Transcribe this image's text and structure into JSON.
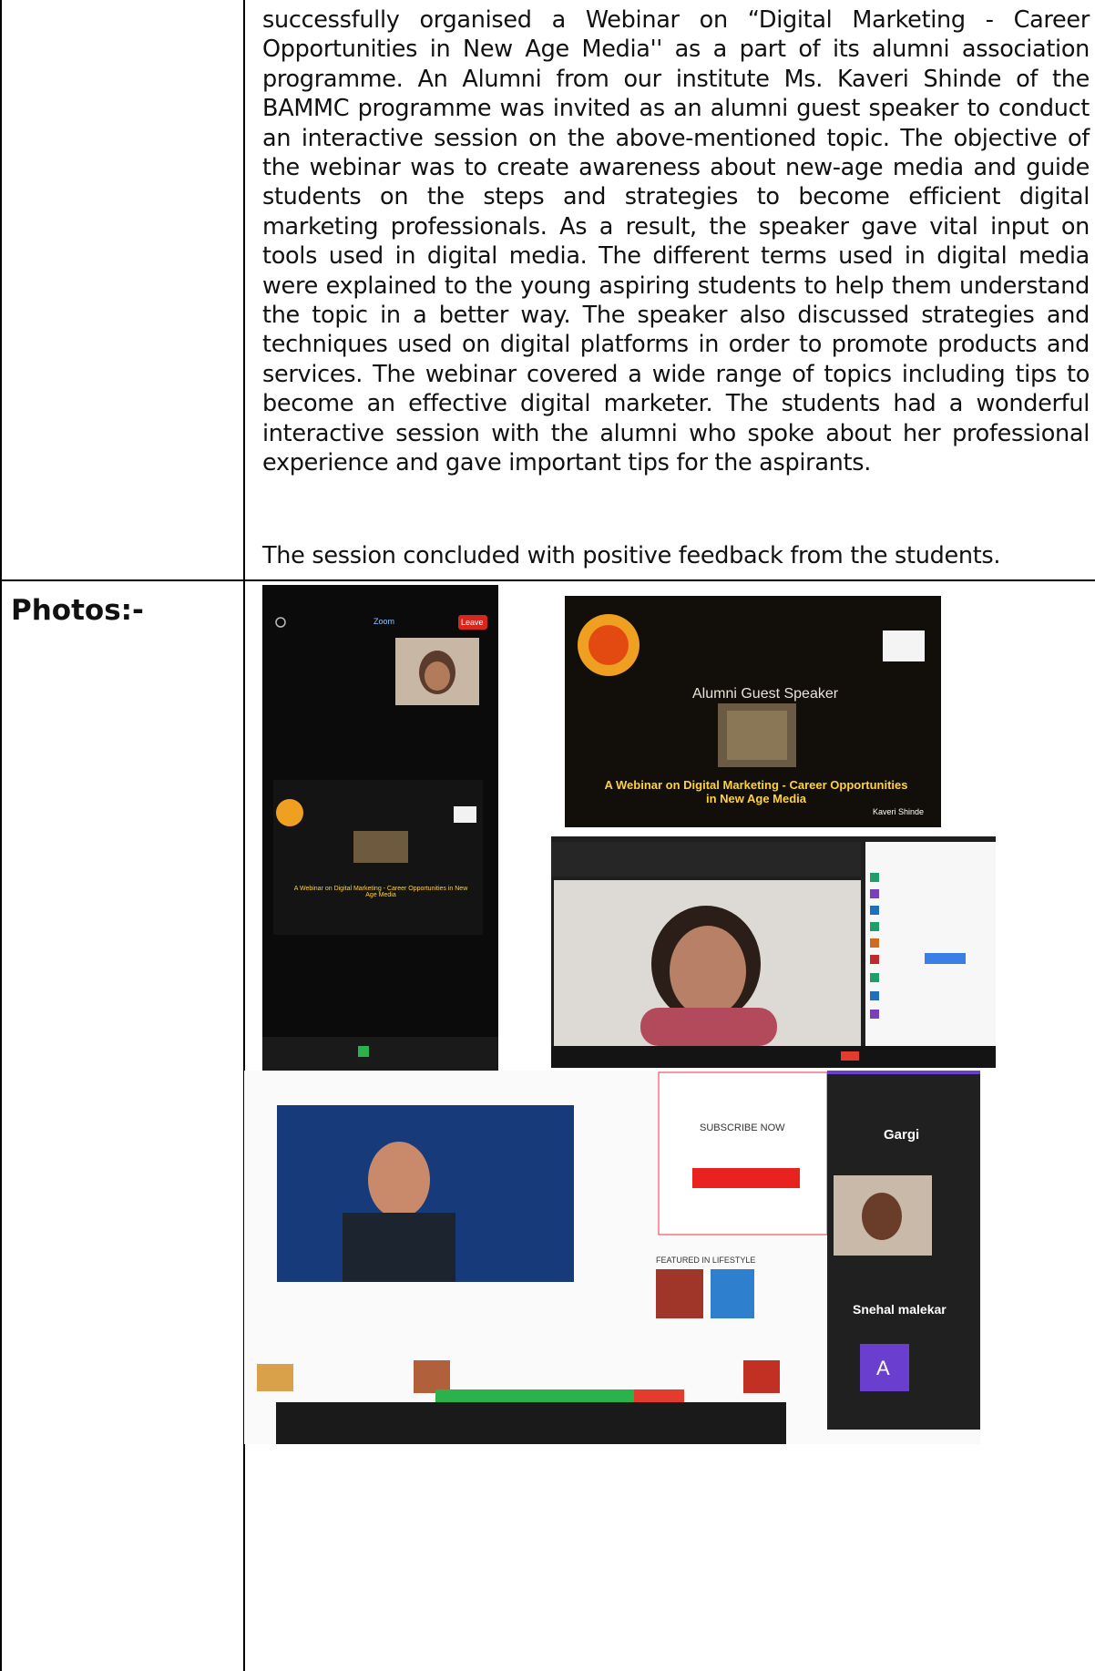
{
  "document": {
    "body_paragraph": "successfully organised a Webinar on “Digital Marketing - Career Opportunities in New Age Media'' as a part of its alumni association programme. An Alumni from our institute Ms. Kaveri Shinde of the BAMMC programme was invited as an alumni guest speaker to conduct an interactive session on the above-mentioned topic. The objective of the webinar was to create awareness about new-age media and guide students on the steps and strategies to become efficient digital marketing professionals. As a result, the speaker gave vital input on tools used in digital media. The different terms used in digital media were explained to the young aspiring students to help them understand the topic in a better way. The speaker also discussed strategies and techniques used on digital platforms in order to promote products and services. The webinar covered a wide range of topics including tips to become an effective digital marketer. The students had a wonderful interactive session with the alumni who spoke about her professional experience and gave important tips for the aspirants.",
    "closing_paragraph": "The session concluded with positive feedback from the students.",
    "photos_label": "Photos:-"
  },
  "photos": {
    "poster": {
      "heading": "Alumni Guest Speaker",
      "title": "A Webinar on Digital Marketing - Career Opportunities in New Age Media",
      "speaker": "Kaveri Shinde"
    },
    "phone": {
      "zoom_label": "Zoom",
      "leave_label": "Leave"
    },
    "participants": {
      "name_1": "Gargi",
      "name_2": "Snehal malekar",
      "avatar_letter": "A"
    },
    "news_page": {
      "subscribe_heading": "SUBSCRIBE NOW",
      "featured_heading": "FEATURED IN LIFESTYLE"
    }
  },
  "colors": {
    "zoom_dark": "#111111",
    "poster_gold": "#ffb400",
    "avatar_purple": "#6a3fd0",
    "subscribe_red": "#e8231f"
  }
}
